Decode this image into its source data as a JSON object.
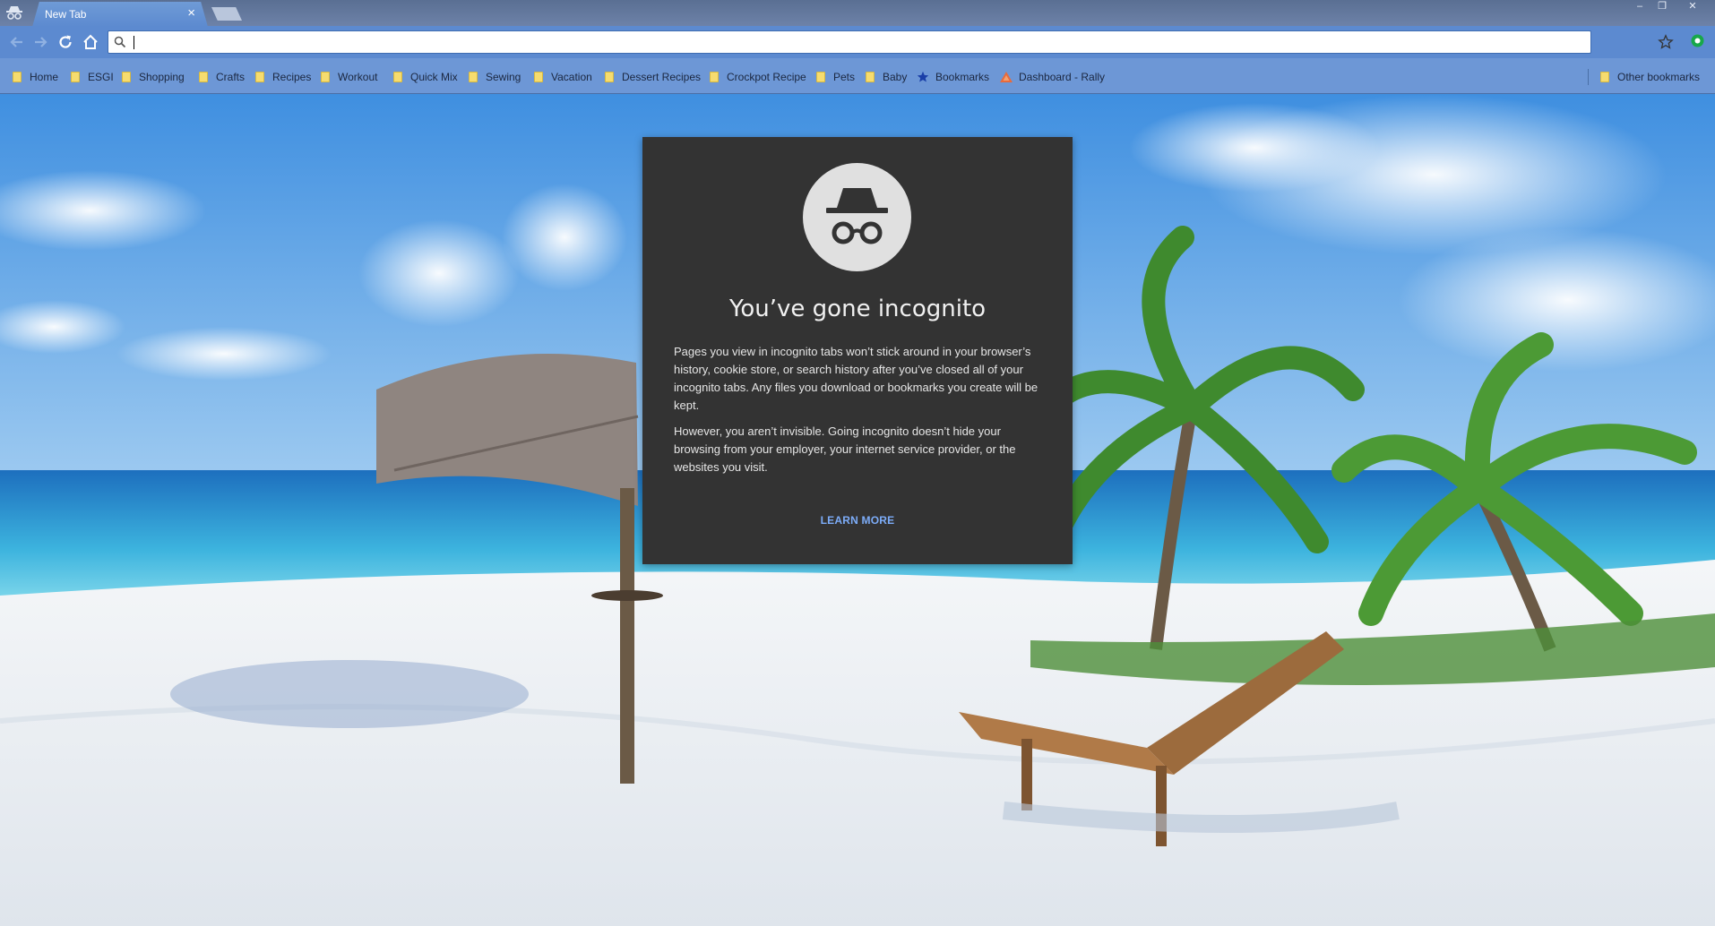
{
  "browser": {
    "tab": {
      "title": "New Tab",
      "close_glyph": "×"
    },
    "window_controls": {
      "minimize": "–",
      "maximize": "❐",
      "close": "✕"
    },
    "omnibox": {
      "value": ""
    }
  },
  "bookmarks": {
    "items": [
      {
        "label": "Home",
        "icon": "folder-icon"
      },
      {
        "label": "ESGI",
        "icon": "folder-icon"
      },
      {
        "label": "Shopping",
        "icon": "folder-icon"
      },
      {
        "label": "Crafts",
        "icon": "folder-icon"
      },
      {
        "label": "Recipes",
        "icon": "folder-icon"
      },
      {
        "label": "Workout",
        "icon": "folder-icon"
      },
      {
        "label": "Quick Mix",
        "icon": "folder-icon"
      },
      {
        "label": "Sewing",
        "icon": "folder-icon"
      },
      {
        "label": "Vacation",
        "icon": "folder-icon"
      },
      {
        "label": "Dessert Recipes",
        "icon": "folder-icon"
      },
      {
        "label": "Crockpot Recipe",
        "icon": "folder-icon"
      },
      {
        "label": "Pets",
        "icon": "folder-icon"
      },
      {
        "label": "Baby",
        "icon": "folder-icon"
      },
      {
        "label": "Bookmarks",
        "icon": "star-icon"
      },
      {
        "label": "Dashboard - Rally",
        "icon": "rally-icon"
      }
    ],
    "other": "Other bookmarks"
  },
  "incognito": {
    "title": "You’ve gone incognito",
    "paragraph1": "Pages you view in incognito tabs won’t stick around in your browser’s history, cookie store, or search history after you’ve closed all of your incognito tabs. Any files you download or bookmarks you create will be kept.",
    "paragraph2": "However, you aren’t invisible. Going incognito doesn’t hide your browsing from your employer, your internet service provider, or the websites you visit.",
    "learn_more": "LEARN MORE"
  },
  "colors": {
    "toolbar": "#5c8ad0",
    "card": "#333333",
    "link": "#7cacf8"
  }
}
